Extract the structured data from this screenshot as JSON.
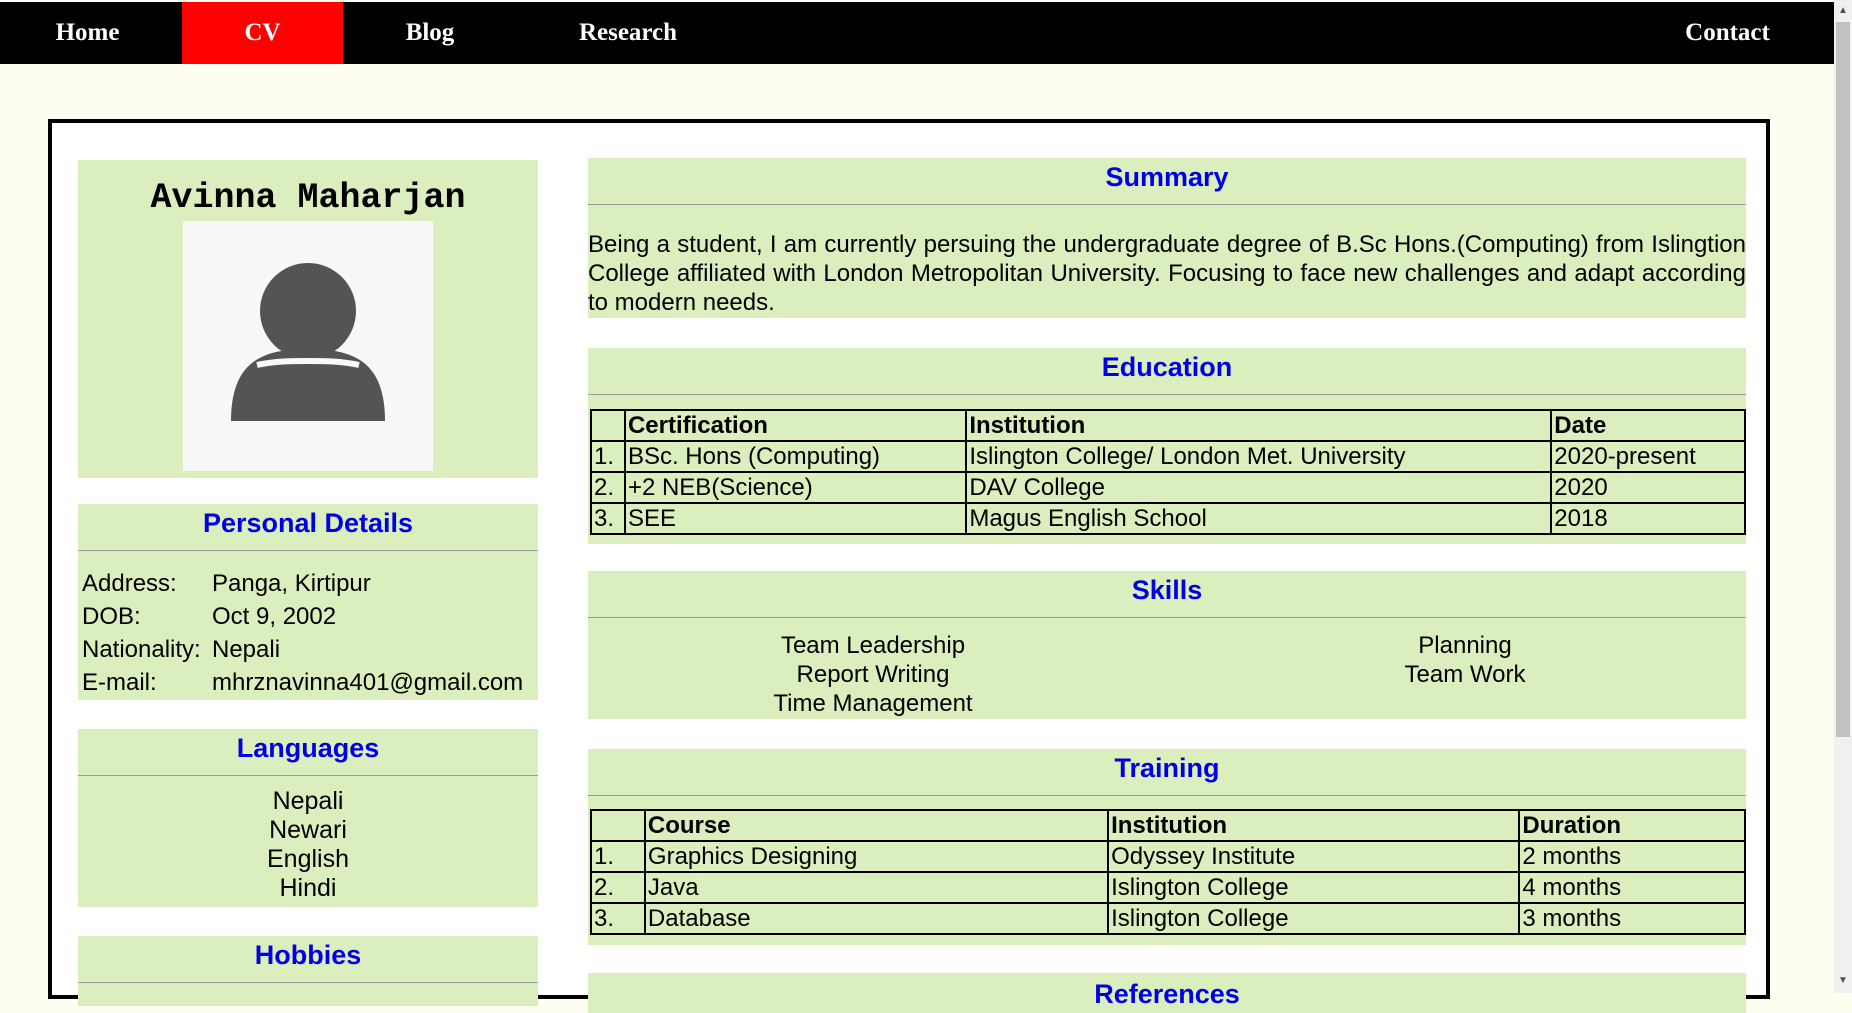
{
  "nav": {
    "items": [
      "Home",
      "CV",
      "Blog",
      "Research"
    ],
    "contact": "Contact",
    "active_color": "#ff0000"
  },
  "profile": {
    "name": "Avinna Maharjan",
    "photo_icon": "user-avatar-icon"
  },
  "personal": {
    "title": "Personal Details",
    "rows": [
      {
        "label": "Address:",
        "value": "Panga, Kirtipur"
      },
      {
        "label": "DOB:",
        "value": "Oct 9, 2002"
      },
      {
        "label": "Nationality:",
        "value": "Nepali"
      },
      {
        "label": "E-mail:",
        "value": "mhrznavinna401@gmail.com"
      }
    ]
  },
  "languages": {
    "title": "Languages",
    "items": [
      "Nepali",
      "Newari",
      "English",
      "Hindi"
    ]
  },
  "hobbies": {
    "title": "Hobbies"
  },
  "summary": {
    "title": "Summary",
    "text": "Being a student, I am currently persuing the undergraduate degree of B.Sc Hons.(Computing) from Islingtion College affiliated with London Metropolitan University. Focusing to face new challenges and adapt according to modern needs."
  },
  "education": {
    "title": "Education",
    "headers": [
      "",
      "Certification",
      "Institution",
      "Date"
    ],
    "rows": [
      [
        "1.",
        "BSc. Hons (Computing)",
        "Islington College/ London Met. University",
        "2020-present"
      ],
      [
        "2.",
        "+2 NEB(Science)",
        "DAV College",
        "2020"
      ],
      [
        "3.",
        "SEE",
        "Magus English School",
        "2018"
      ]
    ]
  },
  "skills": {
    "title": "Skills",
    "left": [
      "Team Leadership",
      "Report Writing",
      "Time Management"
    ],
    "right": [
      "Planning",
      "Team Work"
    ]
  },
  "training": {
    "title": "Training",
    "headers": [
      "",
      "Course",
      "Institution",
      "Duration"
    ],
    "rows": [
      [
        "1.",
        "Graphics Designing",
        "Odyssey Institute",
        "2 months"
      ],
      [
        "2.",
        "Java",
        "Islington College",
        "4 months"
      ],
      [
        "3.",
        "Database",
        "Islington College",
        "3 months"
      ]
    ]
  },
  "references": {
    "title": "References"
  },
  "colors": {
    "panel": "#dbeebd",
    "heading": "#0000e6",
    "page": "#fdfdf0"
  }
}
